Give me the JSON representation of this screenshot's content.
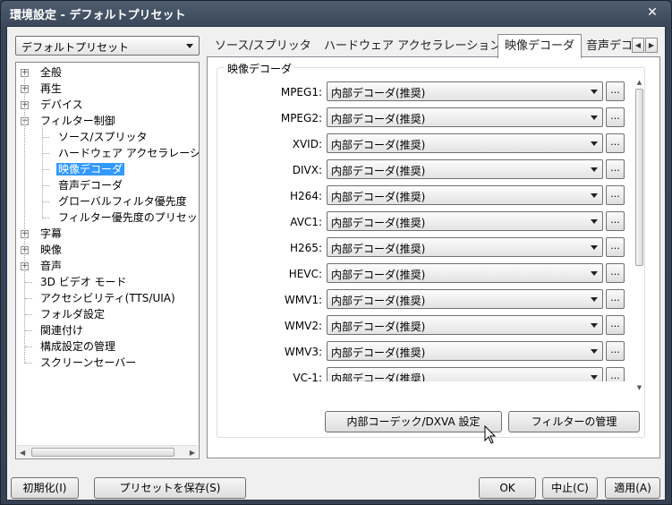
{
  "window": {
    "title": "環境設定 - デフォルトプリセット",
    "close_glyph": "✕"
  },
  "preset": {
    "selected": "デフォルトプリセット"
  },
  "tree": {
    "items": [
      {
        "label": "全般",
        "expander": "+"
      },
      {
        "label": "再生",
        "expander": "+"
      },
      {
        "label": "デバイス",
        "expander": "+"
      },
      {
        "label": "フィルター制御",
        "expander": "−"
      },
      {
        "label": "ソース/スプリッタ"
      },
      {
        "label": "ハードウェア アクセラレーシ"
      },
      {
        "label": "映像デコーダ",
        "selected": true
      },
      {
        "label": "音声デコーダ"
      },
      {
        "label": "グローバルフィルタ優先度"
      },
      {
        "label": "フィルター優先度のプリセッ"
      },
      {
        "label": "字幕",
        "expander": "+"
      },
      {
        "label": "映像",
        "expander": "+"
      },
      {
        "label": "音声",
        "expander": "+"
      },
      {
        "label": "3D ビデオ モード"
      },
      {
        "label": "アクセシビリティ(TTS/UIA)"
      },
      {
        "label": "フォルダ設定"
      },
      {
        "label": "関連付け"
      },
      {
        "label": "構成設定の管理"
      },
      {
        "label": "スクリーンセーバー"
      }
    ]
  },
  "tabs": [
    {
      "label": "ソース/スプリッタ"
    },
    {
      "label": "ハードウェア アクセラレーション"
    },
    {
      "label": "映像デコーダ",
      "active": true
    },
    {
      "label": "音声デコ"
    }
  ],
  "group": {
    "title": "映像デコーダ",
    "decoders": [
      {
        "label": "MPEG1:",
        "value": "内部デコーダ(推奨)"
      },
      {
        "label": "MPEG2:",
        "value": "内部デコーダ(推奨)"
      },
      {
        "label": "XVID:",
        "value": "内部デコーダ(推奨)"
      },
      {
        "label": "DIVX:",
        "value": "内部デコーダ(推奨)"
      },
      {
        "label": "H264:",
        "value": "内部デコーダ(推奨)"
      },
      {
        "label": "AVC1:",
        "value": "内部デコーダ(推奨)"
      },
      {
        "label": "H265:",
        "value": "内部デコーダ(推奨)"
      },
      {
        "label": "HEVC:",
        "value": "内部デコーダ(推奨)"
      },
      {
        "label": "WMV1:",
        "value": "内部デコーダ(推奨)"
      },
      {
        "label": "WMV2:",
        "value": "内部デコーダ(推奨)"
      },
      {
        "label": "WMV3:",
        "value": "内部デコーダ(推奨)"
      },
      {
        "label": "VC-1:",
        "value": "内部デコーダ(推奨)"
      }
    ],
    "dots_label": "...",
    "codec_button": "内部コーデック/DXVA 設定",
    "filter_button": "フィルターの管理"
  },
  "footer": {
    "init_button": "初期化(I)",
    "save_preset_button": "プリセットを保存(S)",
    "ok_button": "OK",
    "cancel_button": "中止(C)",
    "apply_button": "適用(A)"
  }
}
